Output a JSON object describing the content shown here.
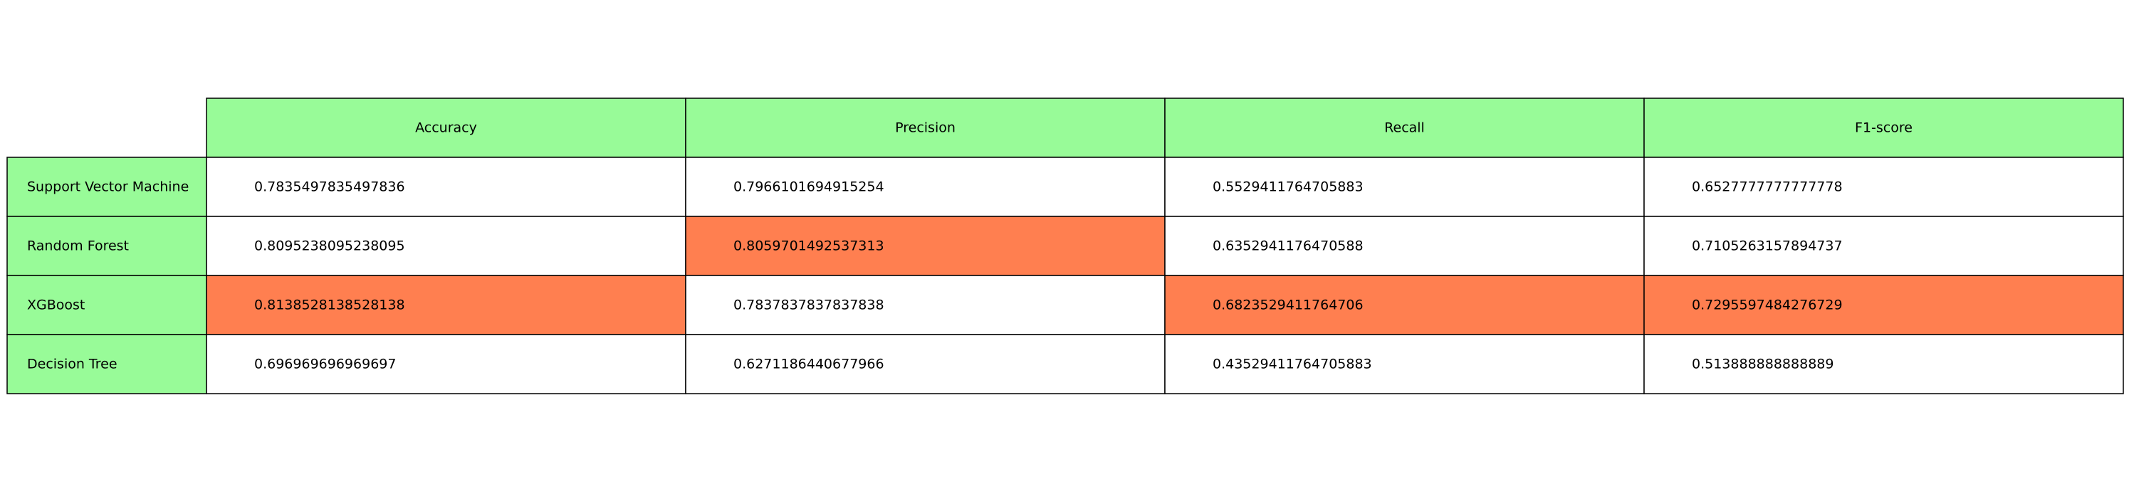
{
  "chart_data": {
    "type": "table",
    "columns": [
      "Accuracy",
      "Precision",
      "Recall",
      "F1-score"
    ],
    "rows": [
      {
        "label": "Support Vector Machine",
        "values": [
          "0.7835497835497836",
          "0.7966101694915254",
          "0.5529411764705883",
          "0.6527777777777778"
        ],
        "highlight": [
          false,
          false,
          false,
          false
        ]
      },
      {
        "label": "Random Forest",
        "values": [
          "0.8095238095238095",
          "0.8059701492537313",
          "0.6352941176470588",
          "0.7105263157894737"
        ],
        "highlight": [
          false,
          true,
          false,
          false
        ]
      },
      {
        "label": "XGBoost",
        "values": [
          "0.8138528138528138",
          "0.7837837837837838",
          "0.6823529411764706",
          "0.7295597484276729"
        ],
        "highlight": [
          true,
          false,
          true,
          true
        ]
      },
      {
        "label": "Decision Tree",
        "values": [
          "0.696969696969697",
          "0.6271186440677966",
          "0.43529411764705883",
          "0.513888888888889"
        ],
        "highlight": [
          false,
          false,
          false,
          false
        ]
      }
    ]
  },
  "colors": {
    "header_fill": "#98fb98",
    "highlight_fill": "#ff7f50",
    "cell_fill": "#ffffff",
    "border": "#000000"
  }
}
